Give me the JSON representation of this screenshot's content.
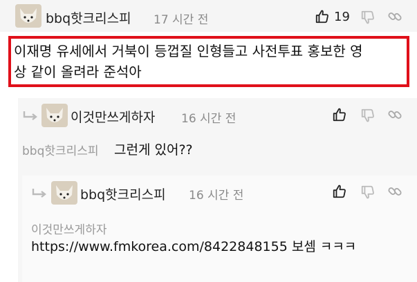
{
  "comment": {
    "author": "bbq핫크리스피",
    "time": "17 시간 전",
    "upvotes": "19",
    "text_line1": "이재명 유세에서 거북이 등껍질 인형들고 사전투표 홍보한 영",
    "text_line2": "상 같이 올려라 준석아"
  },
  "reply1": {
    "author": "이것만쓰게하자",
    "time": "16 시간 전",
    "mention": "bbq핫크리스피",
    "text": "그런게 있어??"
  },
  "reply2": {
    "author": "bbq핫크리스피",
    "time": "16 시간 전",
    "mention": "이것만쓰게하자",
    "text": "https://www.fmkorea.com/8422848155 보셈 ㅋㅋㅋ"
  },
  "colors": {
    "highlight_border": "#e0101a",
    "reply_background": "#f6f6f6"
  },
  "icons": [
    "thumbs-up-icon",
    "thumbs-down-icon",
    "link-icon",
    "reply-arrow-icon",
    "white-fox-avatar"
  ]
}
